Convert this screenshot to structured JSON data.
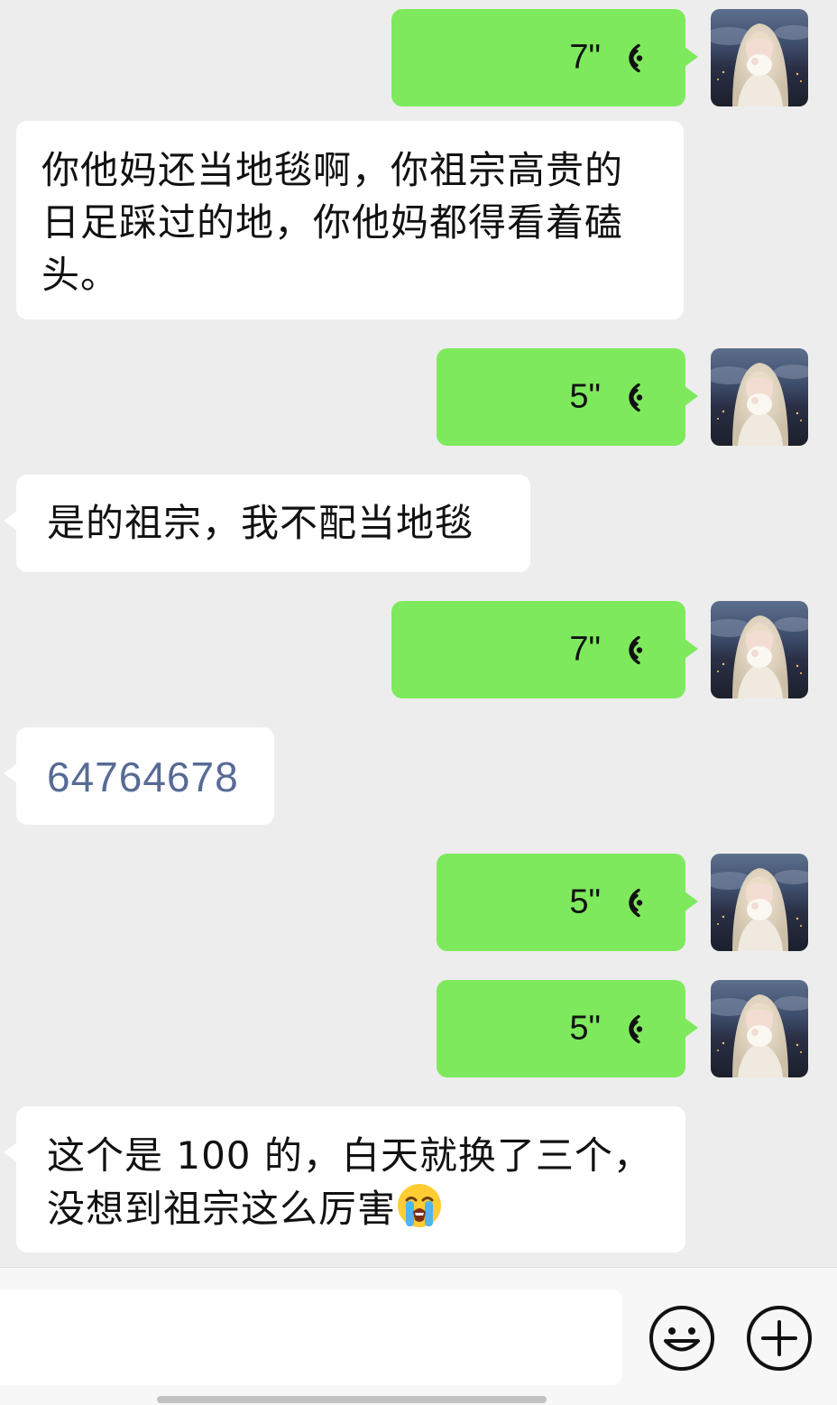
{
  "messages": [
    {
      "side": "out",
      "type": "voice",
      "duration": "7\""
    },
    {
      "side": "in",
      "type": "text",
      "text": "你他妈还当地毯啊，你祖宗高贵的日足踩过的地，你他妈都得看着磕头。"
    },
    {
      "side": "out",
      "type": "voice",
      "duration": "5\""
    },
    {
      "side": "in",
      "type": "text",
      "text": "是的祖宗，我不配当地毯"
    },
    {
      "side": "out",
      "type": "voice",
      "duration": "7\""
    },
    {
      "side": "in",
      "type": "number",
      "text": "64764678"
    },
    {
      "side": "out",
      "type": "voice",
      "duration": "5\""
    },
    {
      "side": "out",
      "type": "voice",
      "duration": "5\""
    },
    {
      "side": "in",
      "type": "text",
      "text": "这个是 100 的，白天就换了三个，没想到祖宗这么厉害",
      "emoji": "loudly-crying-face"
    }
  ],
  "icons": {
    "voice": "voice-wave-icon",
    "emoji_button": "smiley-face-icon",
    "more_button": "plus-circle-icon"
  },
  "colors": {
    "outgoing_bubble": "#7ee95c",
    "incoming_bubble": "#ffffff",
    "link_number": "#576b95",
    "background": "#ededed"
  }
}
